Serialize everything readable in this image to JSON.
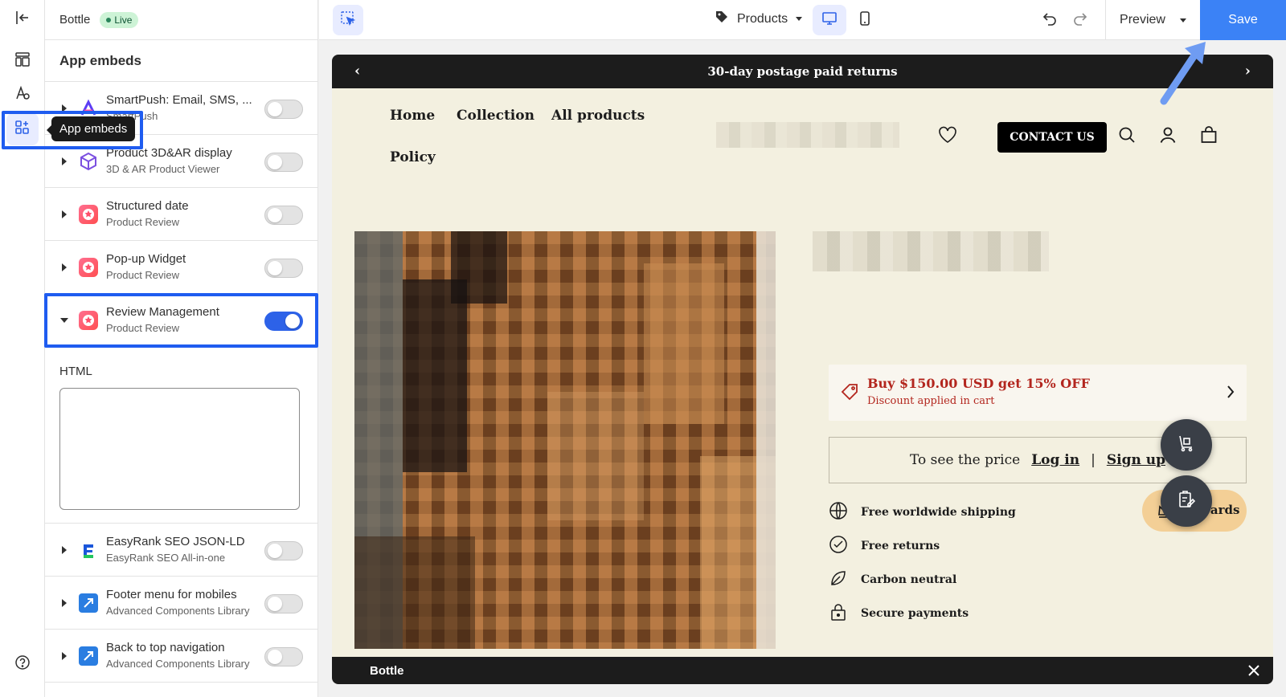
{
  "store": {
    "name": "Bottle",
    "status": "Live"
  },
  "panel": {
    "title": "App embeds",
    "items": [
      {
        "title": "SmartPush: Email, SMS, ...",
        "subtitle": "SmartPush",
        "enabled": false,
        "expanded": false
      },
      {
        "title": "Product 3D&AR display",
        "subtitle": "3D & AR Product Viewer",
        "enabled": false,
        "expanded": false
      },
      {
        "title": "Structured date",
        "subtitle": "Product Review",
        "enabled": false,
        "expanded": false
      },
      {
        "title": "Pop-up Widget",
        "subtitle": "Product Review",
        "enabled": false,
        "expanded": false
      },
      {
        "title": "Review Management",
        "subtitle": "Product Review",
        "enabled": true,
        "expanded": true
      },
      {
        "title": "EasyRank SEO JSON-LD",
        "subtitle": "EasyRank SEO All-in-one",
        "enabled": false,
        "expanded": false
      },
      {
        "title": "Footer menu for mobiles",
        "subtitle": "Advanced Components Library",
        "enabled": false,
        "expanded": false
      },
      {
        "title": "Back to top navigation",
        "subtitle": "Advanced Components Library",
        "enabled": false,
        "expanded": false
      }
    ],
    "html_field": {
      "label": "HTML",
      "value": ""
    }
  },
  "tooltip": {
    "text": "App embeds"
  },
  "topbar": {
    "page_select": "Products",
    "preview_label": "Preview",
    "save_label": "Save"
  },
  "preview": {
    "announcement": "30-day postage paid returns",
    "nav": [
      "Home",
      "Collection",
      "All products",
      "Policy"
    ],
    "contact_label": "CONTACT US",
    "discount": {
      "title": "Buy $150.00 USD get 15% OFF",
      "subtitle": "Discount applied in cart"
    },
    "price_box": {
      "text": "To see the price",
      "login": "Log in",
      "separator": "|",
      "signup": "Sign up"
    },
    "features": [
      "Free worldwide shipping",
      "Free returns",
      "Carbon neutral",
      "Secure payments"
    ],
    "rewards_label": "Rewards",
    "footer_label": "Bottle"
  },
  "colors": {
    "accent": "#2d62e8",
    "save": "#3b82f6",
    "highlight": "#1f5cf0",
    "discount_red": "#b3261e",
    "canvas_bg": "#f3f0e0"
  },
  "icons": [
    "exit-icon",
    "layout-icon",
    "theme-icon",
    "app-embeds-icon",
    "help-icon",
    "select-icon",
    "tag-icon",
    "desktop-icon",
    "mobile-icon",
    "undo-icon",
    "redo-icon",
    "heart-icon",
    "search-icon",
    "account-icon",
    "bag-icon",
    "globe-icon",
    "check-circle-icon",
    "leaf-icon",
    "lock-icon",
    "close-icon"
  ]
}
